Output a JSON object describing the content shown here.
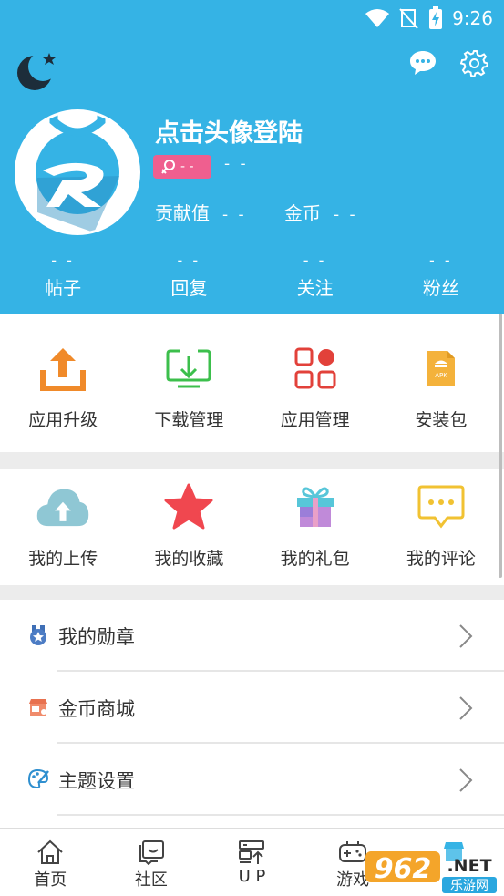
{
  "status_bar": {
    "time": "9:26"
  },
  "header": {
    "login_title": "点击头像登陆",
    "level_value": "- -",
    "contribution_label": "贡献值",
    "contribution_value": "- -",
    "coins_label": "金币",
    "coins_value": "- -",
    "gender_badge_text": "- -",
    "counts": [
      {
        "value": "- -",
        "label": "帖子"
      },
      {
        "value": "- -",
        "label": "回复"
      },
      {
        "value": "- -",
        "label": "关注"
      },
      {
        "value": "- -",
        "label": "粉丝"
      }
    ]
  },
  "tools": [
    {
      "label": "应用升级",
      "icon": "upload-tray-icon",
      "color": "#f08a2a"
    },
    {
      "label": "下载管理",
      "icon": "download-box-icon",
      "color": "#3cbf4c"
    },
    {
      "label": "应用管理",
      "icon": "apps-grid-icon",
      "color": "#e2413a"
    },
    {
      "label": "安装包",
      "icon": "apk-file-icon",
      "color": "#f4b23b"
    }
  ],
  "mine": [
    {
      "label": "我的上传",
      "icon": "cloud-upload-icon",
      "color": "#8fc7d4"
    },
    {
      "label": "我的收藏",
      "icon": "star-icon",
      "color": "#f0474f"
    },
    {
      "label": "我的礼包",
      "icon": "gift-icon",
      "color": "#b77ad6"
    },
    {
      "label": "我的评论",
      "icon": "comment-bubble-icon",
      "color": "#f1c232"
    }
  ],
  "list": [
    {
      "label": "我的勋章",
      "icon": "medal-icon"
    },
    {
      "label": "金币商城",
      "icon": "shop-icon"
    },
    {
      "label": "主题设置",
      "icon": "palette-icon"
    }
  ],
  "bottom_nav": [
    {
      "label": "首页",
      "icon": "home-icon"
    },
    {
      "label": "社区",
      "icon": "community-icon"
    },
    {
      "label": "U P",
      "icon": "up-server-icon"
    },
    {
      "label": "游戏",
      "icon": "gamepad-icon"
    }
  ],
  "watermark": {
    "number": "962",
    "suffix": ".NET",
    "subtitle": "乐游网"
  },
  "colors": {
    "header": "#35b3e5",
    "badge": "#ef5f8f"
  }
}
